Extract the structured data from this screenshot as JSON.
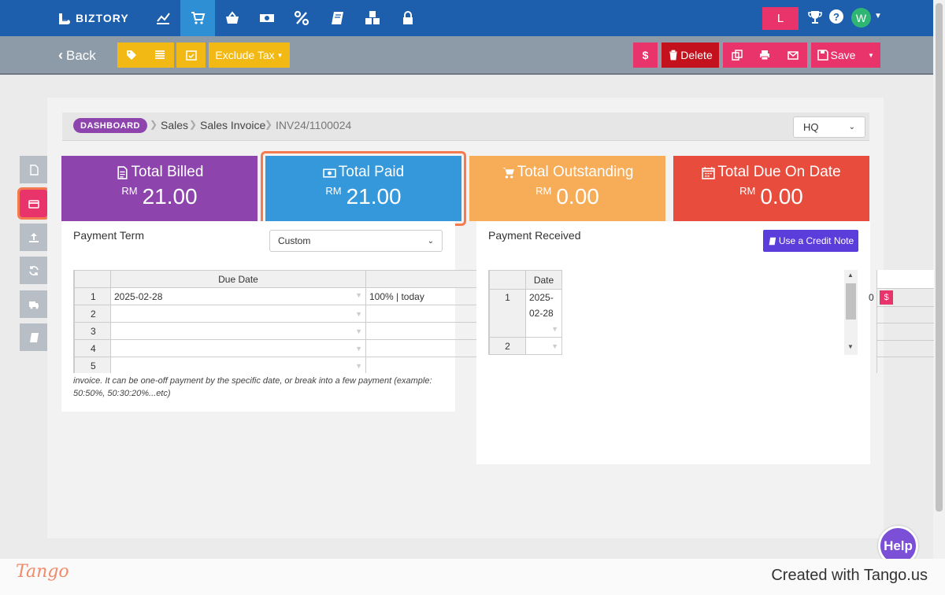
{
  "app": {
    "logo_text": "BIZTORY"
  },
  "user": {
    "initial_badge": "L",
    "avatar_initial": "W"
  },
  "toolbar": {
    "back_label": "Back",
    "exclude_tax_label": "Exclude Tax",
    "delete_label": "Delete",
    "save_label": "Save"
  },
  "breadcrumb": {
    "dashboard": "DASHBOARD",
    "sales": "Sales",
    "sales_invoice": "Sales Invoice",
    "invoice_no": "INV24/1100024"
  },
  "branch_select": {
    "value": "HQ"
  },
  "cards": {
    "total_billed": {
      "title": "Total Billed",
      "currency": "RM",
      "amount": "21.00"
    },
    "total_paid": {
      "title": "Total Paid",
      "currency": "RM",
      "amount": "21.00"
    },
    "total_outstanding": {
      "title": "Total Outstanding",
      "currency": "RM",
      "amount": "0.00"
    },
    "total_due_on_date": {
      "title": "Total Due On Date",
      "currency": "RM",
      "amount": "0.00"
    }
  },
  "payment_term": {
    "title": "Payment Term",
    "select_value": "Custom",
    "column_due_date": "Due Date",
    "rows": [
      {
        "num": "1",
        "date": "2025-02-28",
        "detail": "100% |  today"
      },
      {
        "num": "2",
        "date": "",
        "detail": ""
      },
      {
        "num": "3",
        "date": "",
        "detail": ""
      },
      {
        "num": "4",
        "date": "",
        "detail": ""
      },
      {
        "num": "5",
        "date": "",
        "detail": ""
      }
    ],
    "note": "invoice. It can be one-off payment by the specific date, or break into a few payment (example: 50:50%, 50:30:20%...etc)"
  },
  "payment_received": {
    "title": "Payment Received",
    "credit_note_button": "Use a Credit Note",
    "column_date": "Date",
    "rows": [
      {
        "num": "1",
        "date_line1": "2025-",
        "date_line2": "02-28"
      },
      {
        "num": "2",
        "date_line1": "",
        "date_line2": ""
      }
    ],
    "partial_value": "0"
  },
  "help_label": "Help",
  "footer": {
    "brand": "Tango",
    "created_text": "Created with Tango.us"
  }
}
